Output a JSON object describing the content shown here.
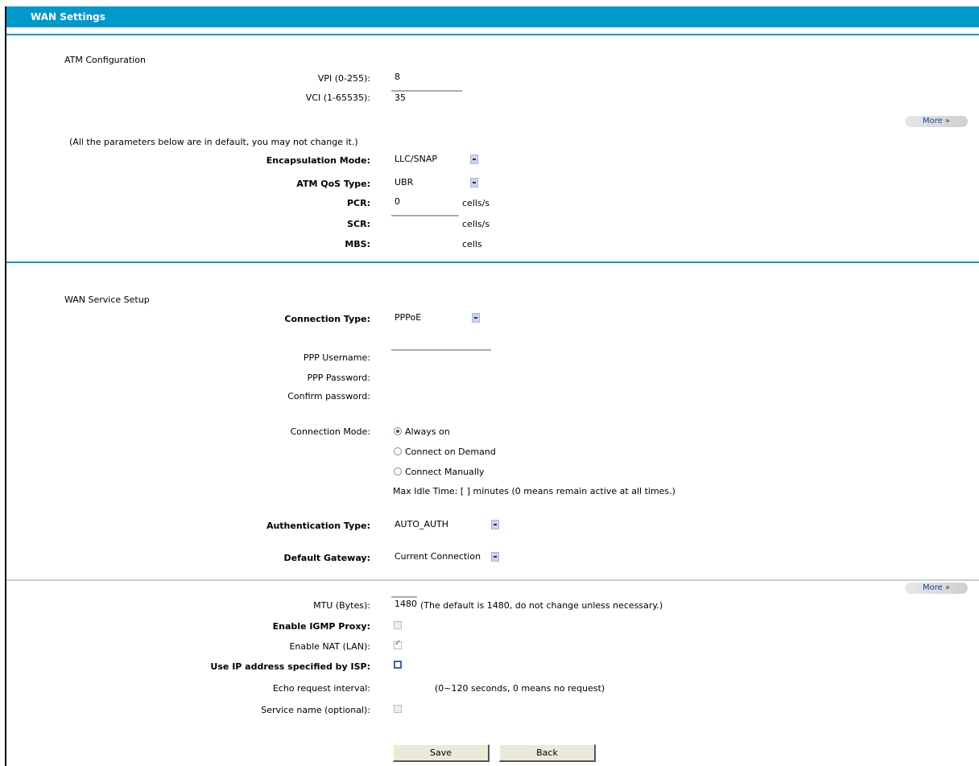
{
  "title": "WAN Settings",
  "atm": {
    "section": "ATM Configuration",
    "vpi_label": "VPI (0-255):",
    "vpi_value": "8",
    "vci_label": "VCI (1-65535):",
    "vci_value": "35",
    "more_label": "More »",
    "note": "(All the parameters below are in default, you may not change it.)",
    "encap_label": "Encapsulation Mode:",
    "encap_value": "LLC/SNAP",
    "qos_label": "ATM QoS Type:",
    "qos_value": "UBR",
    "pcr_label": "PCR:",
    "pcr_value": "0",
    "pcr_unit": "cells/s",
    "scr_label": "SCR:",
    "scr_unit": "cells/s",
    "mbs_label": "MBS:",
    "mbs_unit": "cells"
  },
  "wan": {
    "section": "WAN Service Setup",
    "conn_type_label": "Connection Type:",
    "conn_type_value": "PPPoE",
    "ppp_user_label": "PPP Username:",
    "ppp_pass_label": "PPP Password:",
    "confirm_label": "Confirm password:",
    "conn_mode_label": "Connection Mode:",
    "mode_always": "Always on",
    "mode_demand": "Connect on Demand",
    "mode_manual": "Connect Manually",
    "idle_text": "Max Idle Time: [ ] minutes (0 means remain active at all times.)",
    "auth_label": "Authentication Type:",
    "auth_value": "AUTO_AUTH",
    "gw_label": "Default Gateway:",
    "gw_value": "Current Connection",
    "more2_label": "More »",
    "mtu_label": "MTU (Bytes):",
    "mtu_value": "1480",
    "mtu_note": "(The default is 1480, do not change unless necessary.)",
    "proxy_label": "Enable IGMP Proxy:",
    "nat_label": "Enable NAT (LAN):",
    "ipaddr_label": "Use IP address specified by ISP:",
    "echo_label": "Echo request interval:",
    "echo_note": "(0~120 seconds, 0 means no request)",
    "svc_label": "Service name (optional):"
  },
  "buttons": {
    "save": "Save",
    "back": "Back"
  }
}
